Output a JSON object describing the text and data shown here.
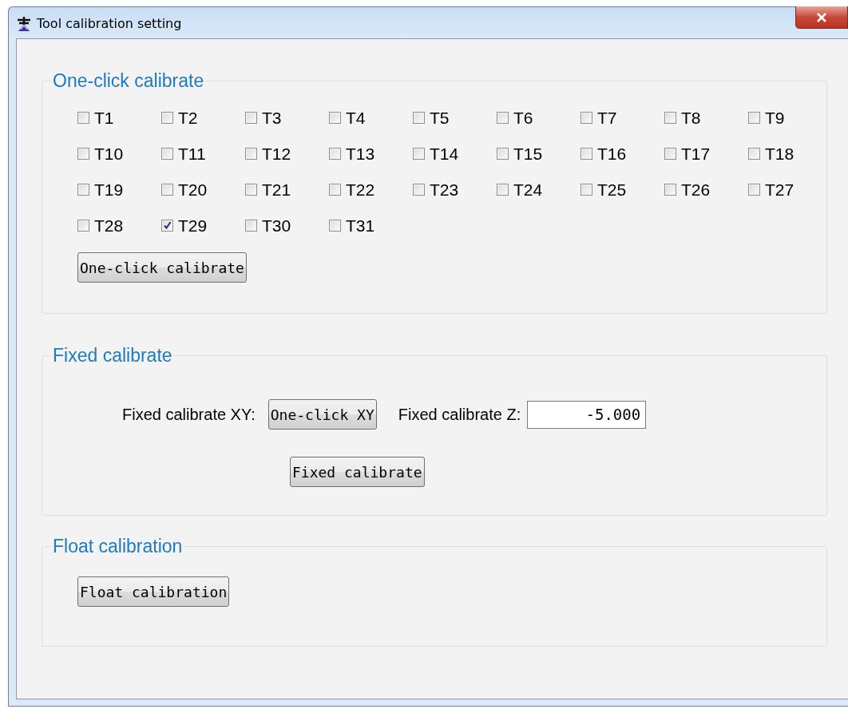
{
  "window": {
    "title": "Tool calibration setting"
  },
  "one_click": {
    "legend": "One-click calibrate",
    "tools": [
      {
        "label": "T1",
        "checked": false
      },
      {
        "label": "T2",
        "checked": false
      },
      {
        "label": "T3",
        "checked": false
      },
      {
        "label": "T4",
        "checked": false
      },
      {
        "label": "T5",
        "checked": false
      },
      {
        "label": "T6",
        "checked": false
      },
      {
        "label": "T7",
        "checked": false
      },
      {
        "label": "T8",
        "checked": false
      },
      {
        "label": "T9",
        "checked": false
      },
      {
        "label": "T10",
        "checked": false
      },
      {
        "label": "T11",
        "checked": false
      },
      {
        "label": "T12",
        "checked": false
      },
      {
        "label": "T13",
        "checked": false
      },
      {
        "label": "T14",
        "checked": false
      },
      {
        "label": "T15",
        "checked": false
      },
      {
        "label": "T16",
        "checked": false
      },
      {
        "label": "T17",
        "checked": false
      },
      {
        "label": "T18",
        "checked": false
      },
      {
        "label": "T19",
        "checked": false
      },
      {
        "label": "T20",
        "checked": false
      },
      {
        "label": "T21",
        "checked": false
      },
      {
        "label": "T22",
        "checked": false
      },
      {
        "label": "T23",
        "checked": false
      },
      {
        "label": "T24",
        "checked": false
      },
      {
        "label": "T25",
        "checked": false
      },
      {
        "label": "T26",
        "checked": false
      },
      {
        "label": "T27",
        "checked": false
      },
      {
        "label": "T28",
        "checked": false
      },
      {
        "label": "T29",
        "checked": true
      },
      {
        "label": "T30",
        "checked": false
      },
      {
        "label": "T31",
        "checked": false
      }
    ],
    "button": "One-click calibrate"
  },
  "fixed": {
    "legend": "Fixed calibrate",
    "xy_label": "Fixed calibrate XY:",
    "xy_button": "One-click XY",
    "z_label": "Fixed calibrate Z:",
    "z_value": "-5.000",
    "button": "Fixed calibrate"
  },
  "float": {
    "legend": "Float calibration",
    "button": "Float calibration"
  }
}
